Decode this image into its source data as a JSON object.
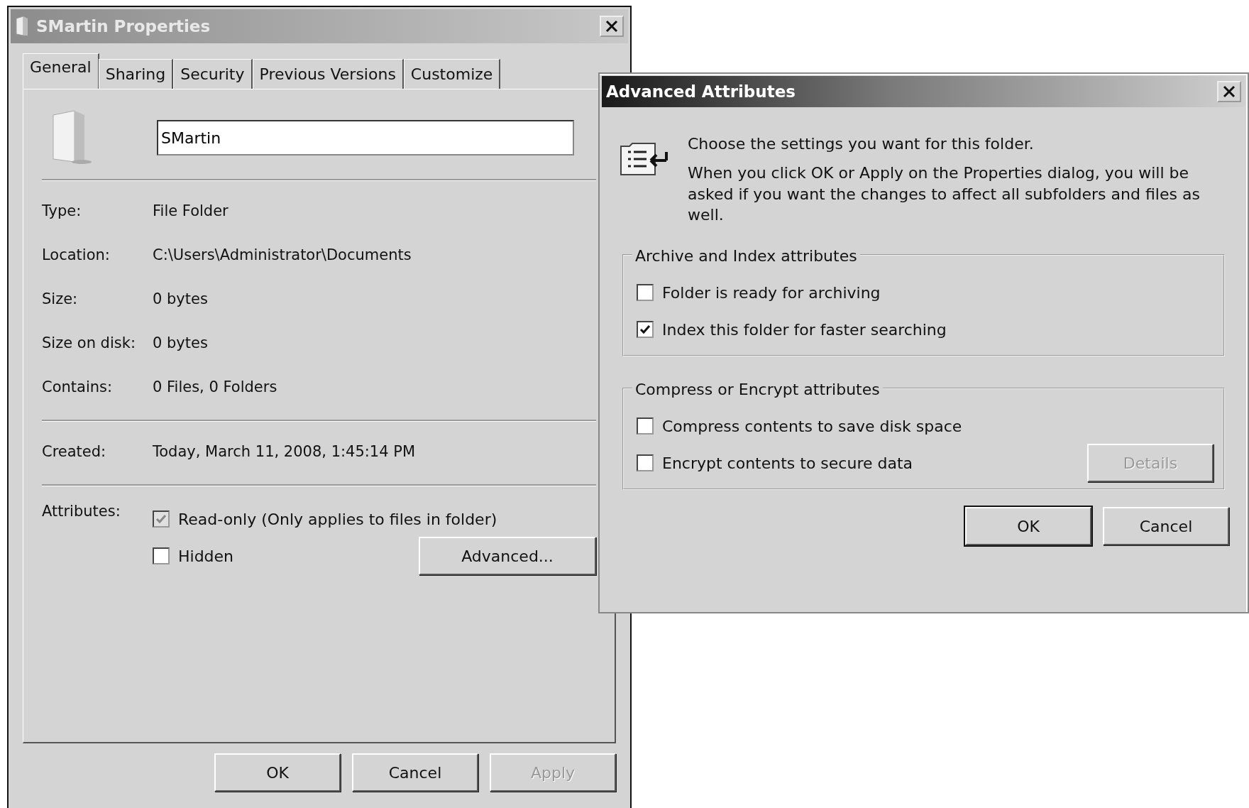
{
  "properties_window": {
    "title": "SMartin Properties",
    "tabs": [
      {
        "label": "General",
        "selected": true
      },
      {
        "label": "Sharing",
        "selected": false
      },
      {
        "label": "Security",
        "selected": false
      },
      {
        "label": "Previous Versions",
        "selected": false
      },
      {
        "label": "Customize",
        "selected": false
      }
    ],
    "name_field": {
      "value": "SMartin"
    },
    "sections": [
      [
        {
          "label": "Type:",
          "value": "File Folder"
        },
        {
          "label": "Location:",
          "value": "C:\\Users\\Administrator\\Documents"
        },
        {
          "label": "Size:",
          "value": "0 bytes"
        },
        {
          "label": "Size on disk:",
          "value": "0 bytes"
        },
        {
          "label": "Contains:",
          "value": "0 Files, 0 Folders"
        }
      ],
      [
        {
          "label": "Created:",
          "value": "Today, March 11, 2008, 1:45:14 PM"
        }
      ]
    ],
    "attributes": {
      "label": "Attributes:",
      "options": [
        {
          "label": "Read-only (Only applies to files in folder)",
          "checked": true,
          "disabled": true
        },
        {
          "label": "Hidden",
          "checked": false,
          "disabled": false
        }
      ],
      "button": "Advanced..."
    },
    "buttons": [
      {
        "label": "OK",
        "disabled": false
      },
      {
        "label": "Cancel",
        "disabled": false
      },
      {
        "label": "Apply",
        "disabled": true
      }
    ]
  },
  "advanced_dialog": {
    "title": "Advanced Attributes",
    "intro": "Choose the settings you want for this folder.",
    "note": "When you click OK or Apply on the Properties dialog, you will be asked if you want the changes to affect all subfolders and files as well.",
    "groups": [
      {
        "title": "Archive and Index attributes",
        "options": [
          {
            "label": "Folder is ready for archiving",
            "checked": false
          },
          {
            "label": "Index this folder for faster searching",
            "checked": true
          }
        ]
      },
      {
        "title": "Compress or Encrypt attributes",
        "options": [
          {
            "label": "Compress contents to save disk space",
            "checked": false
          },
          {
            "label": "Encrypt contents to secure data",
            "checked": false
          }
        ],
        "button": {
          "label": "Details",
          "disabled": true
        }
      }
    ],
    "buttons": [
      {
        "label": "OK",
        "default": true
      },
      {
        "label": "Cancel",
        "default": false
      }
    ]
  }
}
